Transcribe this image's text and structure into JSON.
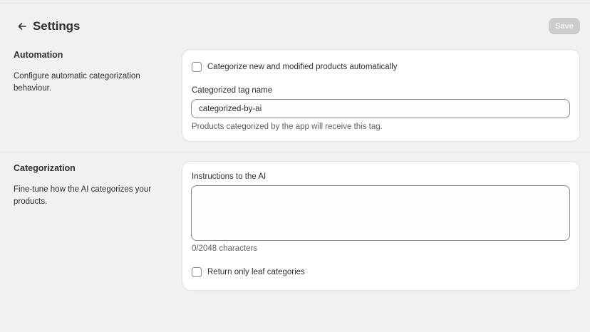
{
  "header": {
    "title": "Settings",
    "save_label": "Save"
  },
  "automation": {
    "title": "Automation",
    "description": "Configure automatic categorization behaviour.",
    "auto_checkbox_label": "Categorize new and modified products automatically",
    "auto_checked": false,
    "tag_label": "Categorized tag name",
    "tag_value": "categorized-by-ai",
    "tag_help": "Products categorized by the app will receive this tag."
  },
  "categorization": {
    "title": "Categorization",
    "description": "Fine-tune how the AI categorizes your products.",
    "instructions_label": "Instructions to the AI",
    "instructions_value": "",
    "char_count": "0/2048 characters",
    "leaf_checkbox_label": "Return only leaf categories",
    "leaf_checked": false
  },
  "icons": {
    "back": "arrow-left-icon"
  },
  "colors": {
    "background": "#f1f1f1",
    "card": "#ffffff",
    "save_disabled": "#cccccc",
    "border": "#8a8a8a"
  }
}
